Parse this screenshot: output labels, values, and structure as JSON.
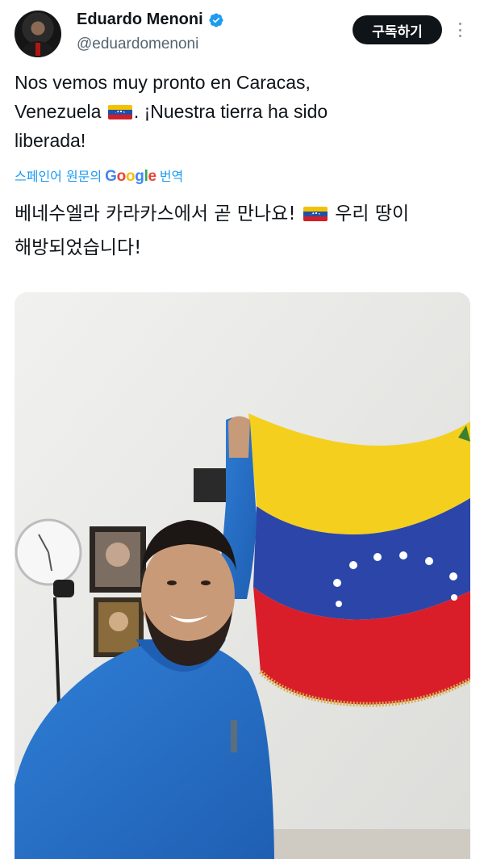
{
  "author": {
    "display_name": "Eduardo Menoni",
    "handle": "@eduardomenoni",
    "verified": true,
    "verified_icon": "verified-badge-icon",
    "verified_color": "#1d9bf0"
  },
  "actions": {
    "subscribe_label": "구독하기",
    "more_icon": "more-vertical-icon"
  },
  "tweet": {
    "text_line1": "Nos vemos muy pronto en Caracas,",
    "text_line2_start": "Venezuela",
    "text_line2_end": ". ¡Nuestra tierra ha sido",
    "text_line3": "liberada!",
    "flag_emoji_icon": "venezuela-flag-icon"
  },
  "translation": {
    "label": "스페인어 원문의",
    "provider": "Google",
    "action": "번역",
    "text_line1_start": "베네수엘라 카라카스에서 곧 만나요!",
    "text_line1_end": "우리 땅이",
    "text_line2": "해방되었습니다!",
    "link_color": "#1d9bf0"
  },
  "media": {
    "type": "photo",
    "description_icon": "photo-media-icon"
  },
  "colors": {
    "text": "#0f1419",
    "secondary": "#536471",
    "button_bg": "#0f1419",
    "flag_yellow": "#f2c200",
    "flag_blue": "#1f4fa8",
    "flag_red": "#cf1e2a"
  }
}
